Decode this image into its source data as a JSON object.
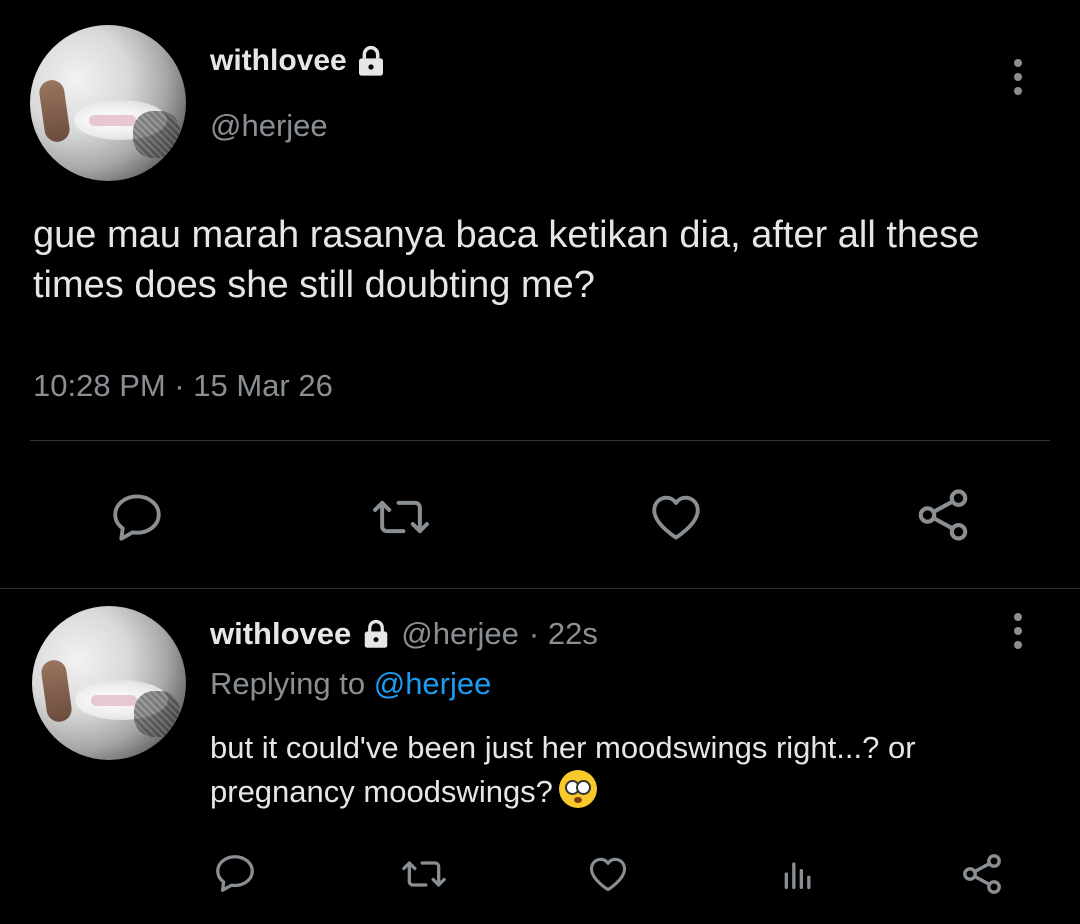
{
  "main_tweet": {
    "display_name": "withlovee",
    "handle": "@herjee",
    "text": "gue mau marah rasanya baca ketikan dia, after all these times does she still doubting me?",
    "timestamp": "10:28 PM · 15 Mar 26",
    "icons": [
      "lock-icon",
      "more-icon",
      "reply-icon",
      "retweet-icon",
      "like-icon",
      "share-icon"
    ]
  },
  "reply_tweet": {
    "display_name": "withlovee",
    "handle": "@herjee",
    "time": "· 22s",
    "replying_label": "Replying to",
    "replying_to": "@herjee",
    "text": "but it could've been just her moodswings right...? or pregnancy moodswings?",
    "emoji": "flushed-face",
    "icons": [
      "lock-icon",
      "more-icon",
      "reply-icon",
      "retweet-icon",
      "like-icon",
      "analytics-icon",
      "share-icon"
    ]
  },
  "colors": {
    "background": "#000000",
    "text": "#e6e6e6",
    "secondary": "#8a8f94",
    "link": "#1d9bf0",
    "divider": "#2f3336"
  }
}
